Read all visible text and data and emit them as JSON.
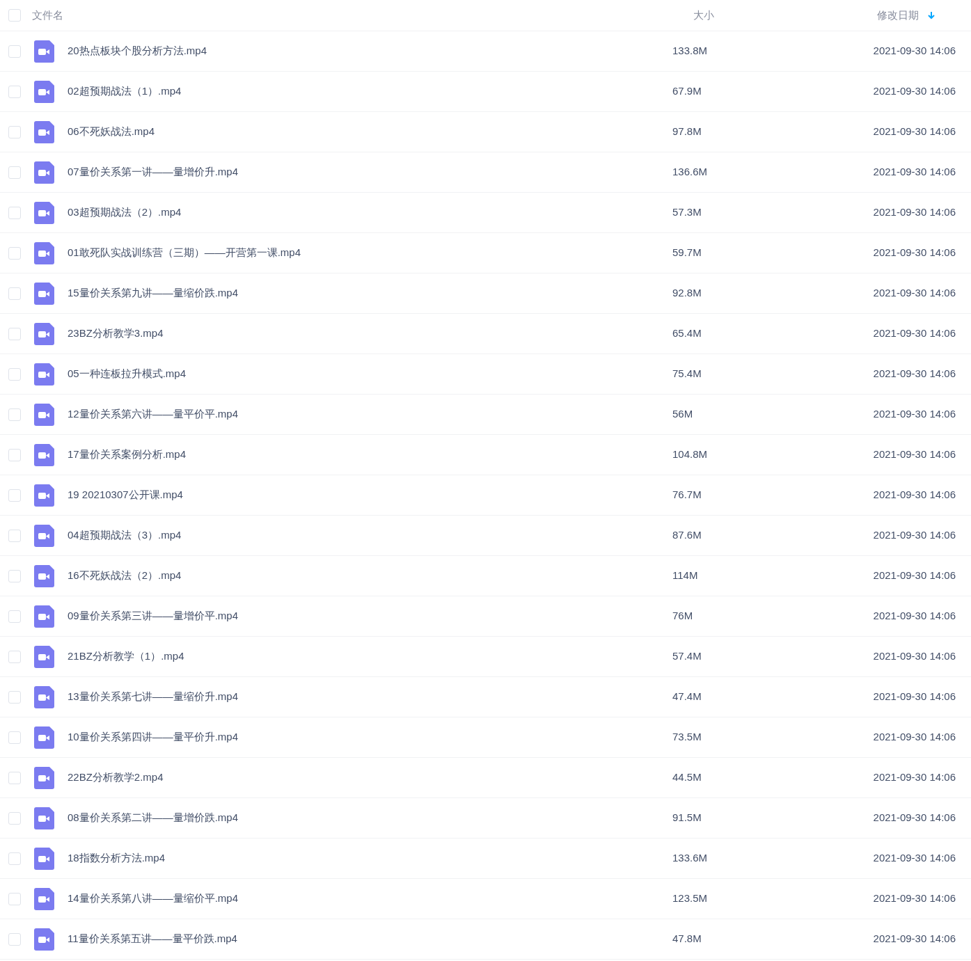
{
  "header": {
    "checked": false,
    "columns": [
      {
        "label": "文件名",
        "sorted": false
      },
      {
        "label": "大小",
        "sorted": false
      },
      {
        "label": "修改日期",
        "sorted": true
      }
    ]
  },
  "rows": [
    {
      "name": "20热点板块个股分析方法.mp4",
      "size": "133.8M",
      "date": "2021-09-30 14:06",
      "checked": false
    },
    {
      "name": "02超预期战法（1）.mp4",
      "size": "67.9M",
      "date": "2021-09-30 14:06",
      "checked": false
    },
    {
      "name": "06不死妖战法.mp4",
      "size": "97.8M",
      "date": "2021-09-30 14:06",
      "checked": false
    },
    {
      "name": "07量价关系第一讲——量增价升.mp4",
      "size": "136.6M",
      "date": "2021-09-30 14:06",
      "checked": false
    },
    {
      "name": "03超预期战法（2）.mp4",
      "size": "57.3M",
      "date": "2021-09-30 14:06",
      "checked": false
    },
    {
      "name": "01敢死队实战训练营（三期）——开营第一课.mp4",
      "size": "59.7M",
      "date": "2021-09-30 14:06",
      "checked": false
    },
    {
      "name": "15量价关系第九讲——量缩价跌.mp4",
      "size": "92.8M",
      "date": "2021-09-30 14:06",
      "checked": false
    },
    {
      "name": "23BZ分析教学3.mp4",
      "size": "65.4M",
      "date": "2021-09-30 14:06",
      "checked": false
    },
    {
      "name": "05一种连板拉升模式.mp4",
      "size": "75.4M",
      "date": "2021-09-30 14:06",
      "checked": false
    },
    {
      "name": "12量价关系第六讲——量平价平.mp4",
      "size": "56M",
      "date": "2021-09-30 14:06",
      "checked": false
    },
    {
      "name": "17量价关系案例分析.mp4",
      "size": "104.8M",
      "date": "2021-09-30 14:06",
      "checked": false
    },
    {
      "name": "19 20210307公开课.mp4",
      "size": "76.7M",
      "date": "2021-09-30 14:06",
      "checked": false
    },
    {
      "name": "04超预期战法（3）.mp4",
      "size": "87.6M",
      "date": "2021-09-30 14:06",
      "checked": false
    },
    {
      "name": "16不死妖战法（2）.mp4",
      "size": "114M",
      "date": "2021-09-30 14:06",
      "checked": false
    },
    {
      "name": "09量价关系第三讲——量增价平.mp4",
      "size": "76M",
      "date": "2021-09-30 14:06",
      "checked": false
    },
    {
      "name": "21BZ分析教学（1）.mp4",
      "size": "57.4M",
      "date": "2021-09-30 14:06",
      "checked": false
    },
    {
      "name": "13量价关系第七讲——量缩价升.mp4",
      "size": "47.4M",
      "date": "2021-09-30 14:06",
      "checked": false
    },
    {
      "name": "10量价关系第四讲——量平价升.mp4",
      "size": "73.5M",
      "date": "2021-09-30 14:06",
      "checked": false
    },
    {
      "name": "22BZ分析教学2.mp4",
      "size": "44.5M",
      "date": "2021-09-30 14:06",
      "checked": false
    },
    {
      "name": "08量价关系第二讲——量增价跌.mp4",
      "size": "91.5M",
      "date": "2021-09-30 14:06",
      "checked": false
    },
    {
      "name": "18指数分析方法.mp4",
      "size": "133.6M",
      "date": "2021-09-30 14:06",
      "checked": false
    },
    {
      "name": "14量价关系第八讲——量缩价平.mp4",
      "size": "123.5M",
      "date": "2021-09-30 14:06",
      "checked": false
    },
    {
      "name": "11量价关系第五讲——量平价跌.mp4",
      "size": "47.8M",
      "date": "2021-09-30 14:06",
      "checked": false
    }
  ]
}
